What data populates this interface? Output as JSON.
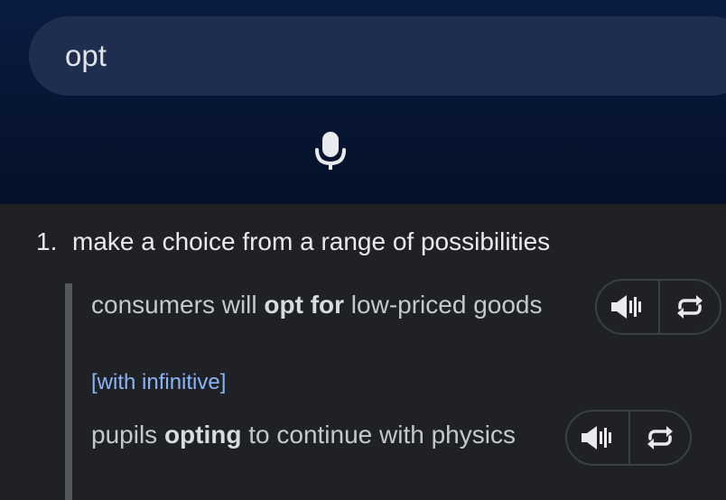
{
  "search": {
    "query": "opt"
  },
  "icons": {
    "mic": "microphone-icon",
    "speaker": "speaker-icon",
    "repeat": "repeat-icon"
  },
  "sense": {
    "number": "1.",
    "definition": "make a choice from a range of possibilities",
    "examples": [
      {
        "before": "consumers will ",
        "bold": "opt for",
        "after": " low-priced goods"
      },
      {
        "before": "pupils ",
        "bold": "opting",
        "after": " to continue with physics"
      }
    ],
    "grammar_note": "[with infinitive]"
  },
  "colors": {
    "header_bg": "#071634",
    "search_bg": "#1f2e4e",
    "content_bg": "#202124",
    "link": "#8ab4f8"
  }
}
